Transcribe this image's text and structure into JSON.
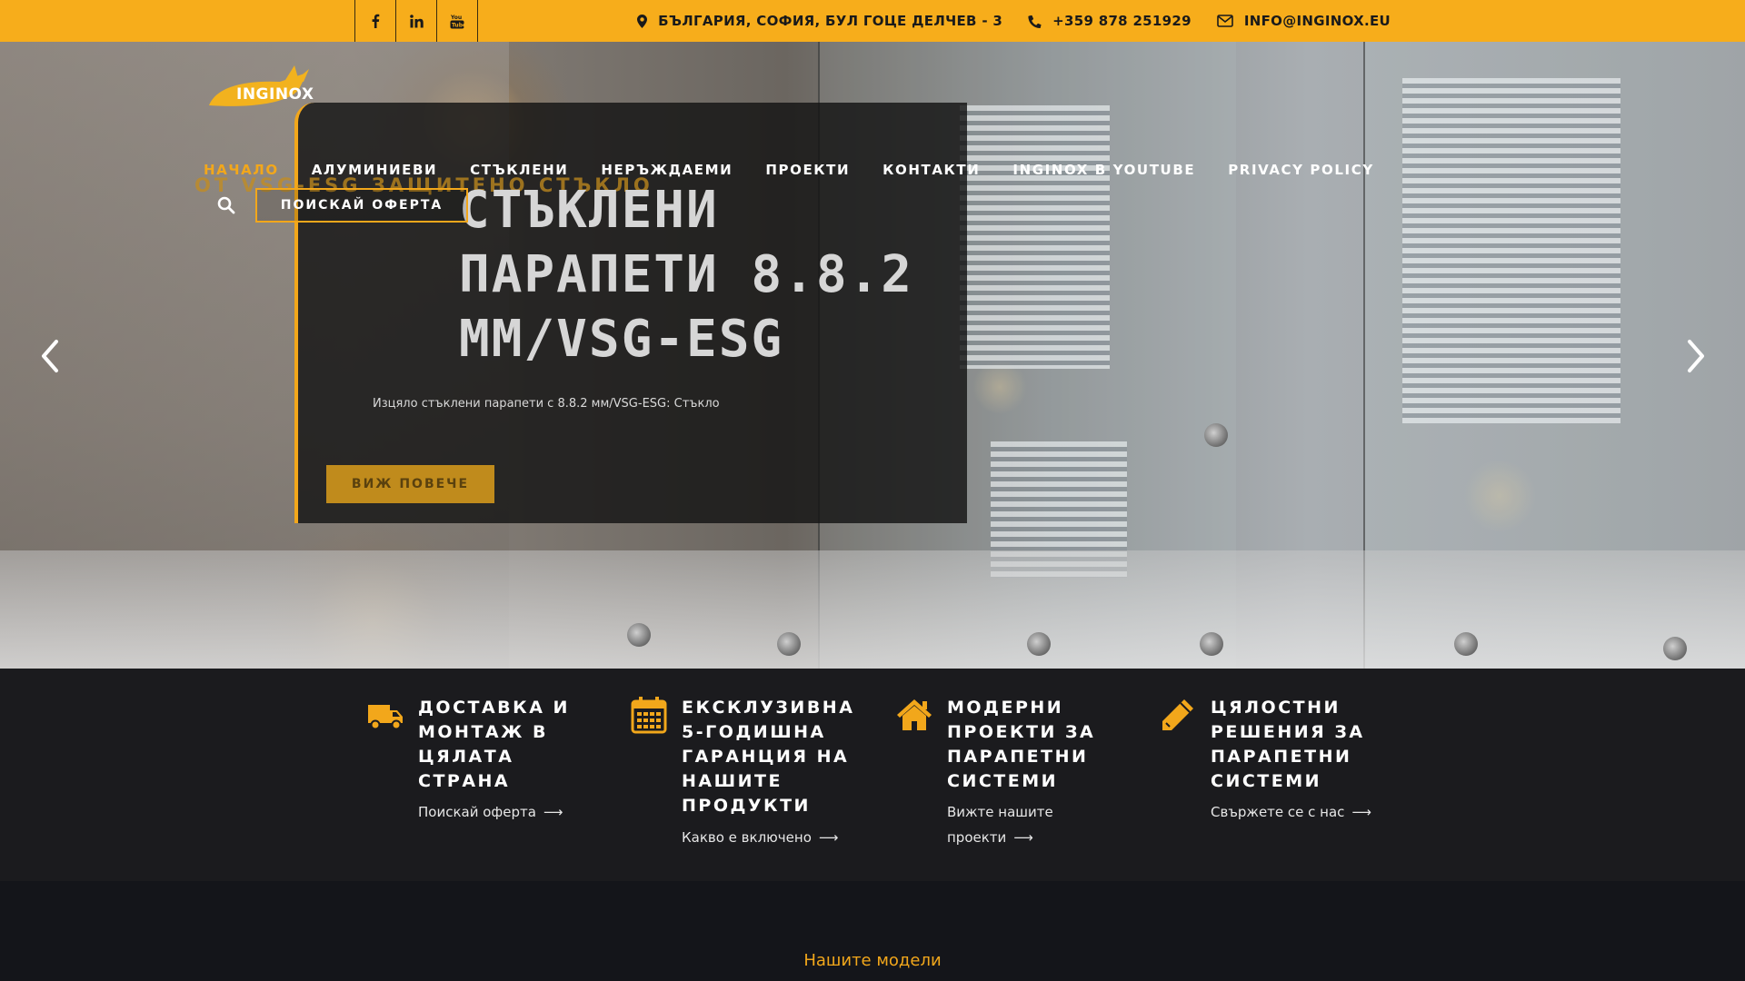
{
  "topbar": {
    "social": [
      {
        "name": "facebook-icon",
        "glyph": "f"
      },
      {
        "name": "linkedin-icon",
        "glyph": "in"
      },
      {
        "name": "youtube-icon",
        "glyph": "▶"
      }
    ],
    "address": "БЪЛГАРИЯ, СОФИЯ, БУЛ ГОЦЕ ДЕЛЧЕВ - 3",
    "phone": "+359 878 251929",
    "email": "INFO@INGINOX.EU",
    "background": "#f7ad1b"
  },
  "logo": {
    "text": "INGINOX"
  },
  "nav": {
    "items": [
      {
        "label": "НАЧАЛО",
        "active": true
      },
      {
        "label": "АЛУМИНИЕВИ",
        "active": false
      },
      {
        "label": "СТЪКЛЕНИ",
        "active": false
      },
      {
        "label": "НЕРЪЖДАЕМИ",
        "active": false
      },
      {
        "label": "ПРОЕКТИ",
        "active": false
      },
      {
        "label": "КОНТАКТИ",
        "active": false
      },
      {
        "label": "INGINOX В YOUTUBE",
        "active": false
      },
      {
        "label": "PRIVACY POLICY",
        "active": false
      }
    ],
    "offer_button": "ПОИСКАЙ ОФЕРТА",
    "accent": "#f2a71b"
  },
  "hero": {
    "ghost_text": "ОТ VSG-ESG ЗАЩИТЕНО СТЪКЛО",
    "title_lines": [
      "СТЪКЛЕНИ",
      "ПАРАПЕТИ 8.8.2",
      "ММ/VSG-ESG"
    ],
    "subtitle": "Изцяло стъклени парапети с 8.8.2 мм/VSG-ESG: Стъкло",
    "button": "ВИЖ ПОВЕЧЕ"
  },
  "features": [
    {
      "icon": "truck-icon",
      "title": "ДОСТАВКА И МОНТАЖ В ЦЯЛАТА СТРАНА",
      "link": "Поискай оферта"
    },
    {
      "icon": "calendar-icon",
      "title": "ЕКСКЛУЗИВНА 5-ГОДИШНА ГАРАНЦИЯ НА НАШИТЕ ПРОДУКТИ",
      "link": "Какво е включено"
    },
    {
      "icon": "home-icon",
      "title": "МОДЕРНИ ПРОЕКТИ ЗА ПАРАПЕТНИ СИСТЕМИ",
      "link": "Вижте нашите проекти"
    },
    {
      "icon": "pencil-icon",
      "title": "ЦЯЛОСТНИ РЕШЕНИЯ ЗА ПАРАПЕТНИ СИСТЕМИ",
      "link": "Свържете се с нас"
    }
  ],
  "models": {
    "title": "Нашите модели"
  }
}
